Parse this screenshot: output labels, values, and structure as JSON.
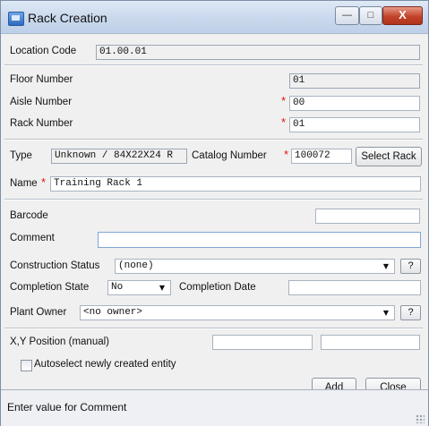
{
  "window": {
    "title": "Rack Creation",
    "minimize": "—",
    "maximize": "□",
    "close": "X"
  },
  "form": {
    "location_code": {
      "label": "Location Code",
      "value": "01.00.01"
    },
    "floor_number": {
      "label": "Floor Number",
      "value": "01"
    },
    "aisle_number": {
      "label": "Aisle Number",
      "value": "00"
    },
    "rack_number": {
      "label": "Rack Number",
      "value": "01"
    },
    "type": {
      "label": "Type",
      "value": "Unknown / 84X22X24 R"
    },
    "catalog_number": {
      "label": "Catalog Number",
      "value": "100072"
    },
    "select_rack": "Select Rack",
    "name": {
      "label": "Name",
      "value": "Training Rack 1"
    },
    "barcode": {
      "label": "Barcode",
      "value": ""
    },
    "comment": {
      "label": "Comment",
      "value": ""
    },
    "construction_status": {
      "label": "Construction Status",
      "value": "(none)"
    },
    "completion_state": {
      "label": "Completion State",
      "value": "No"
    },
    "completion_date": {
      "label": "Completion Date",
      "value": ""
    },
    "plant_owner": {
      "label": "Plant Owner",
      "value": "<no owner>"
    },
    "xy_position": {
      "label": "X,Y Position (manual)",
      "x": "",
      "y": ""
    },
    "autoselect": {
      "label": "Autoselect newly created entity",
      "checked": false
    },
    "help": "?",
    "required_mark": "*"
  },
  "buttons": {
    "add": "Add",
    "close": "Close"
  },
  "status": {
    "text": "Enter value for Comment"
  }
}
